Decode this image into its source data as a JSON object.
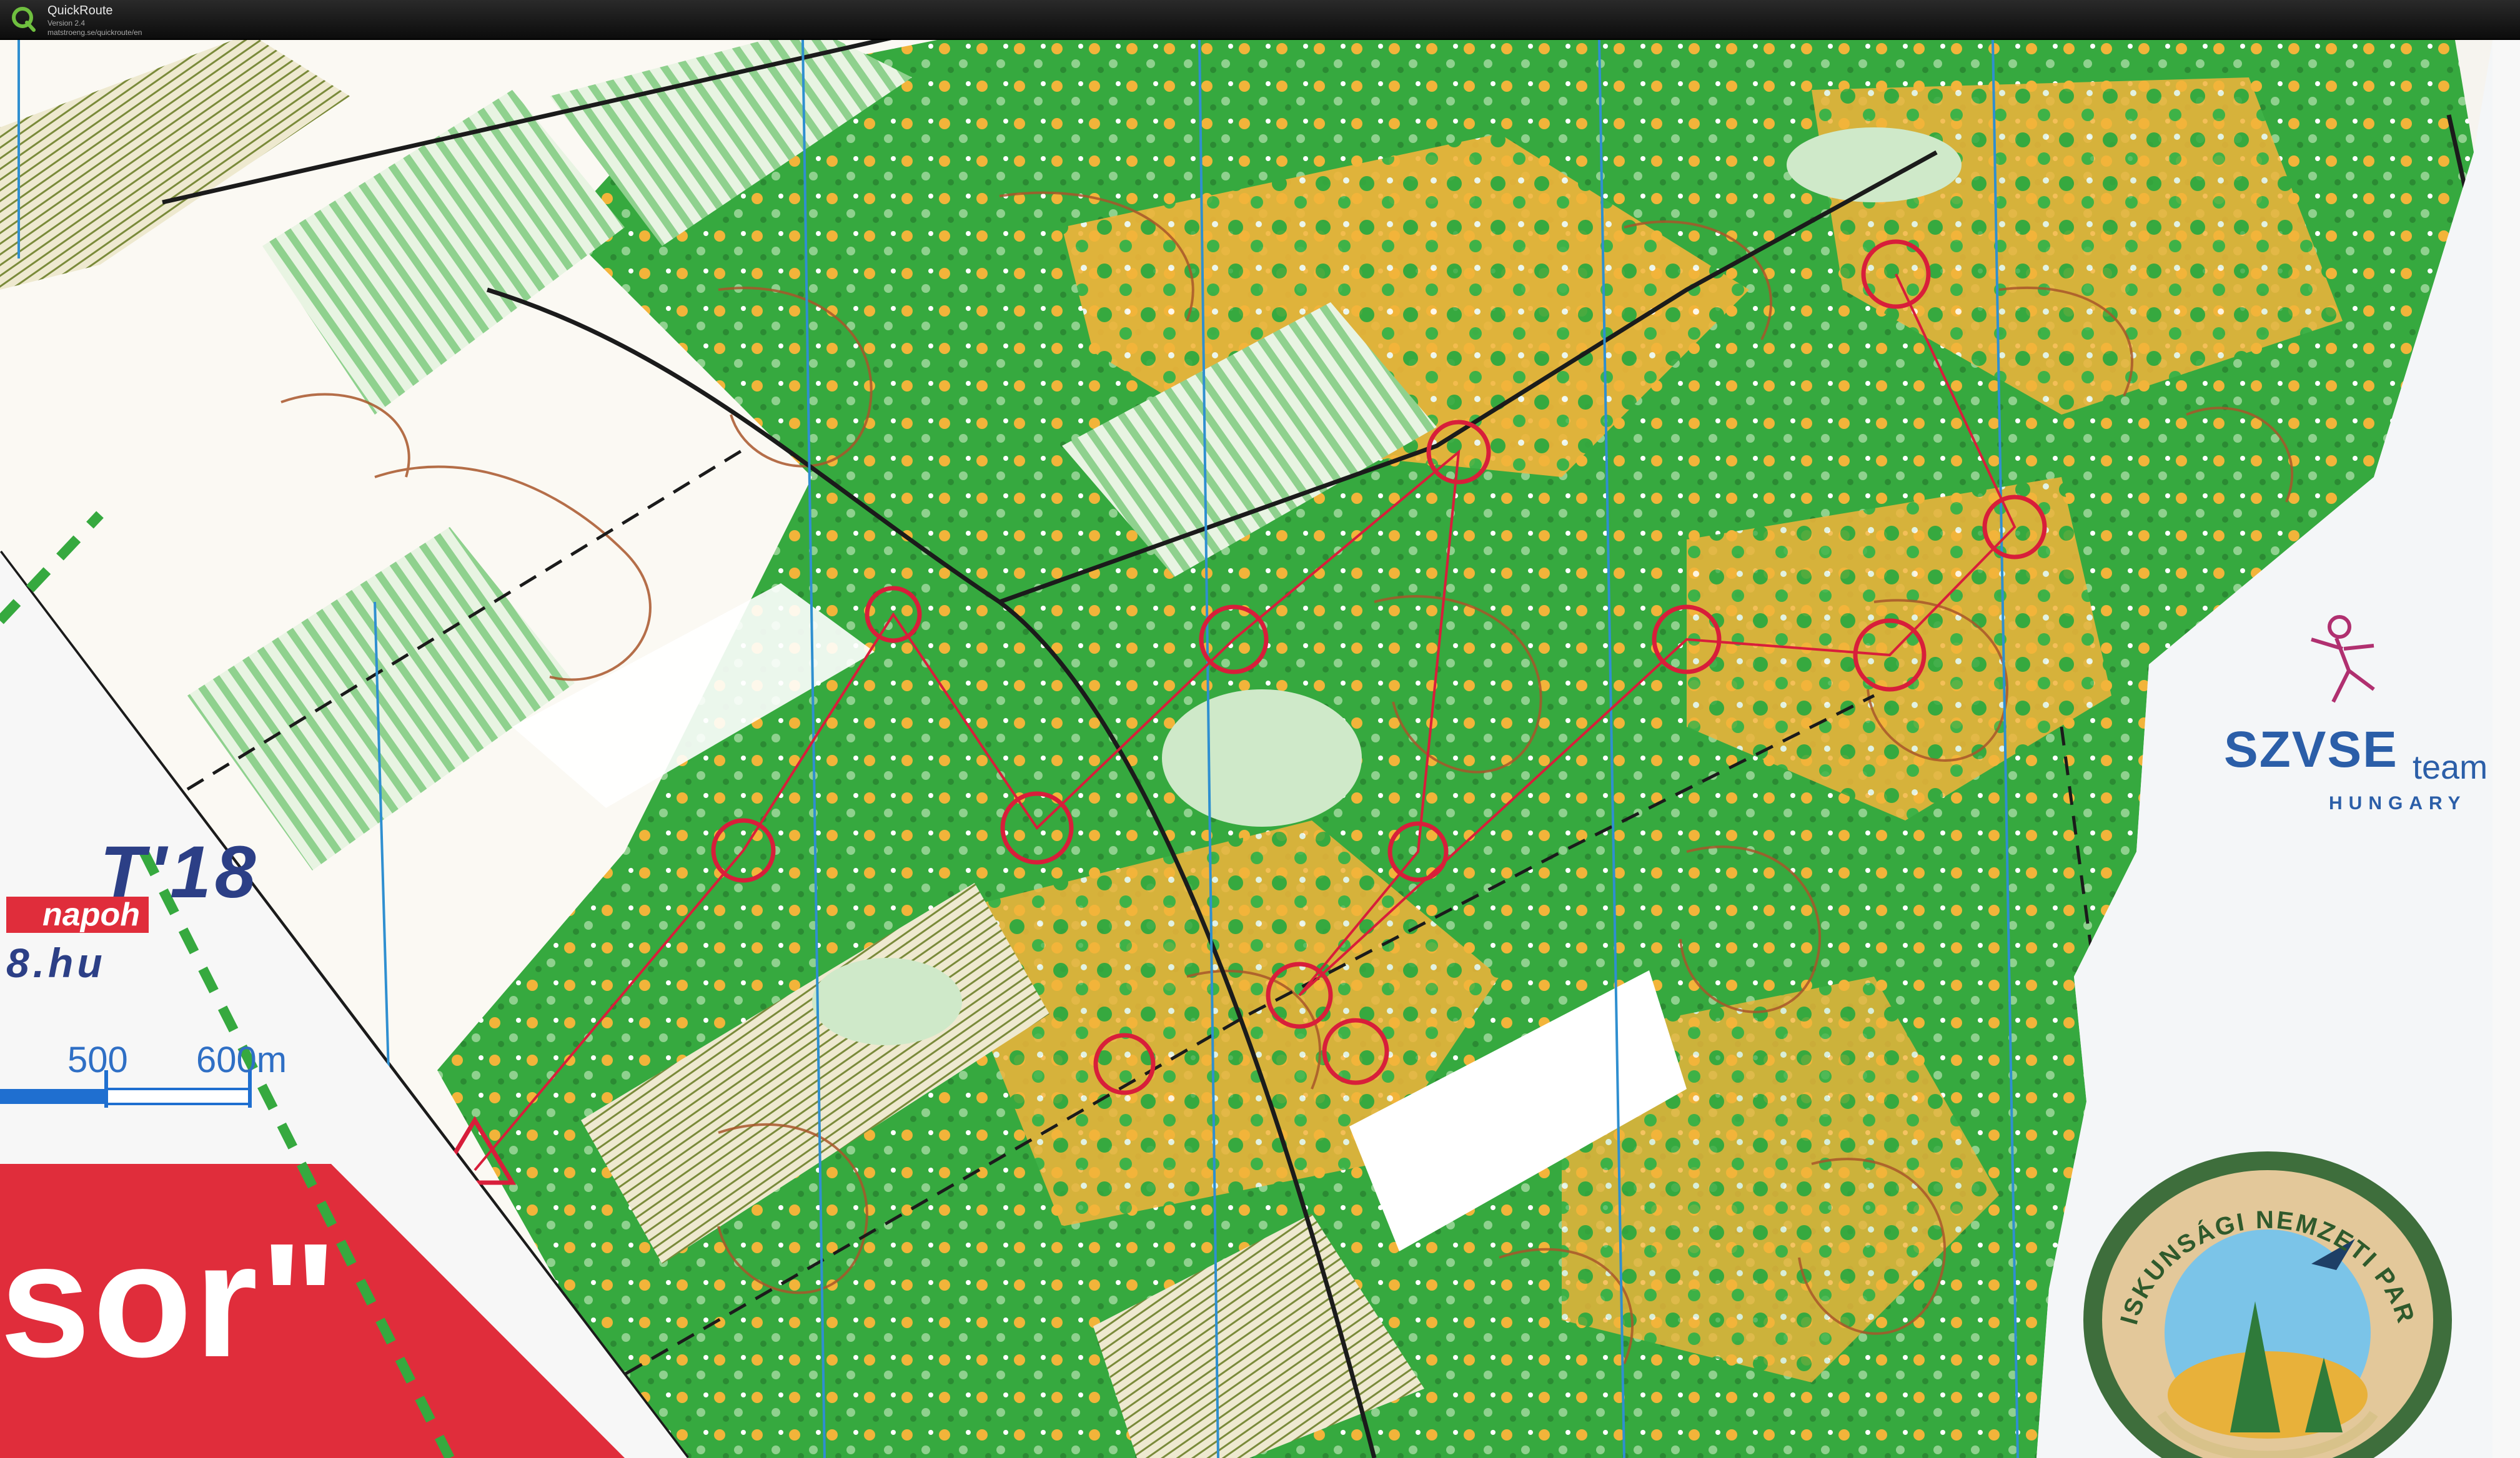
{
  "window": {
    "title": "QuickRoute",
    "version": "Version 2.4",
    "url": "matstroeng.se/quickroute/en"
  },
  "map": {
    "event_year": "T'18",
    "banner_fragment": "napoh",
    "website_fragment": "8.hu",
    "scale_labels": [
      "500",
      "600m"
    ],
    "title_fragment": "sor\"",
    "club_logo": {
      "name": "SZVSE",
      "suffix": "team",
      "country": "HUNGARY"
    },
    "park_logo_text": "KISKUNSÁGI NEMZETI PARK",
    "colors": {
      "forest_green": "#36a93f",
      "light_green": "#8fd18e",
      "open_yellow": "#f2b43a",
      "contour_brown": "#a8562a",
      "course_red": "#d81e3a",
      "water_blue": "#2f8fd0",
      "banner_red": "#e02d3b",
      "logo_blue": "#2b5ea8"
    },
    "icons": [
      "quickroute-icon",
      "runner-icon",
      "park-logo-icon"
    ]
  }
}
